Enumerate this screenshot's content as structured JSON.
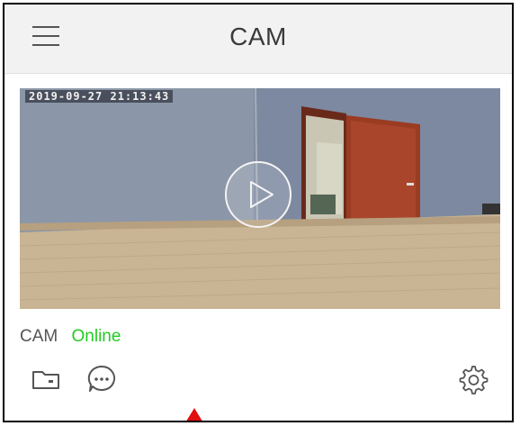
{
  "app": {
    "title": "CAM"
  },
  "camera": {
    "name": "CAM",
    "status": "Online",
    "status_color": "#22cc22",
    "timestamp": "2019-09-27 21:13:43"
  },
  "icons": {
    "menu": "menu-icon",
    "play": "play-icon",
    "folder": "folder-icon",
    "message": "message-icon",
    "settings": "gear-icon",
    "pointer": "pointer-arrow"
  }
}
